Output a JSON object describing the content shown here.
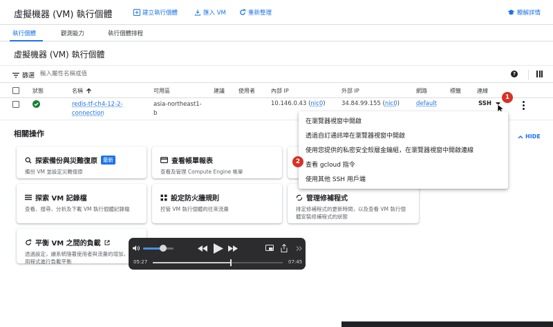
{
  "header": {
    "title": "虛擬機器 (VM) 執行個體",
    "create_label": "建立執行個體",
    "import_label": "匯入 VM",
    "refresh_label": "重新整理",
    "learn_label": "瞭解詳情"
  },
  "tabs": [
    {
      "label": "執行個體"
    },
    {
      "label": "觀測能力"
    },
    {
      "label": "執行個體排程"
    }
  ],
  "section_title": "虛擬機器 (VM) 執行個體",
  "filter": {
    "label": "篩選",
    "placeholder": "輸入屬性名稱或值"
  },
  "table": {
    "headers": [
      "狀態",
      "名稱",
      "可用區",
      "建議",
      "使用者",
      "內部 IP",
      "外部 IP",
      "網路",
      "標籤",
      "連線"
    ],
    "row": {
      "name_line1": "redis-tf-ch4-12-2-",
      "name_line2": "connection",
      "zone_line1": "asia-northeast1-",
      "zone_line2": "b",
      "internal_ip": "10.146.0.43",
      "internal_nic": "nic0",
      "external_ip": "34.84.99.155",
      "external_nic": "nic0",
      "network": "default",
      "connect": "SSH"
    }
  },
  "related": {
    "title": "相關操作",
    "hide_label": "HIDE"
  },
  "cards": [
    {
      "title": "探索備份與災難復原",
      "badge": "最新",
      "desc": "備份 VM 並設定災難復原"
    },
    {
      "title": "查看帳單報表",
      "desc": "查看及管理 Compute Engine 帳單"
    },
    {
      "title": "探索 VM 記錄檔",
      "desc": "查看、搜尋、分析及下載 VM 執行個體記錄檔"
    },
    {
      "title": "設定防火牆規則",
      "desc": "控管 VM 執行個體的往來流量"
    },
    {
      "title": "管理修補程式",
      "desc": "排定修補程式的更新時間，以及查看 VM 執行個體安裝修補程式的狀態"
    },
    {
      "title": "平衡 VM 之間的負載",
      "desc": "透過設定，讓系統隨著使用者與流量的增加，應用程式進行負載平衡"
    }
  ],
  "ssh_menu": [
    "在瀏覽器視窗中開啟",
    "透過自訂通訊埠在瀏覽器視窗中開啟",
    "使用您提供的私密安全殼層金鑰組，在瀏覽器視窗中開啟連線",
    "查看 gcloud 指令",
    "使用其他 SSH 用戶端"
  ],
  "callouts": [
    "1",
    "2"
  ],
  "player": {
    "elapsed": "05:27",
    "remaining": "07:45",
    "progress": 0.6,
    "volume": 0.65
  },
  "colors": {
    "accent": "#1a73e8",
    "running": "#188038",
    "callout": "#d93025"
  }
}
